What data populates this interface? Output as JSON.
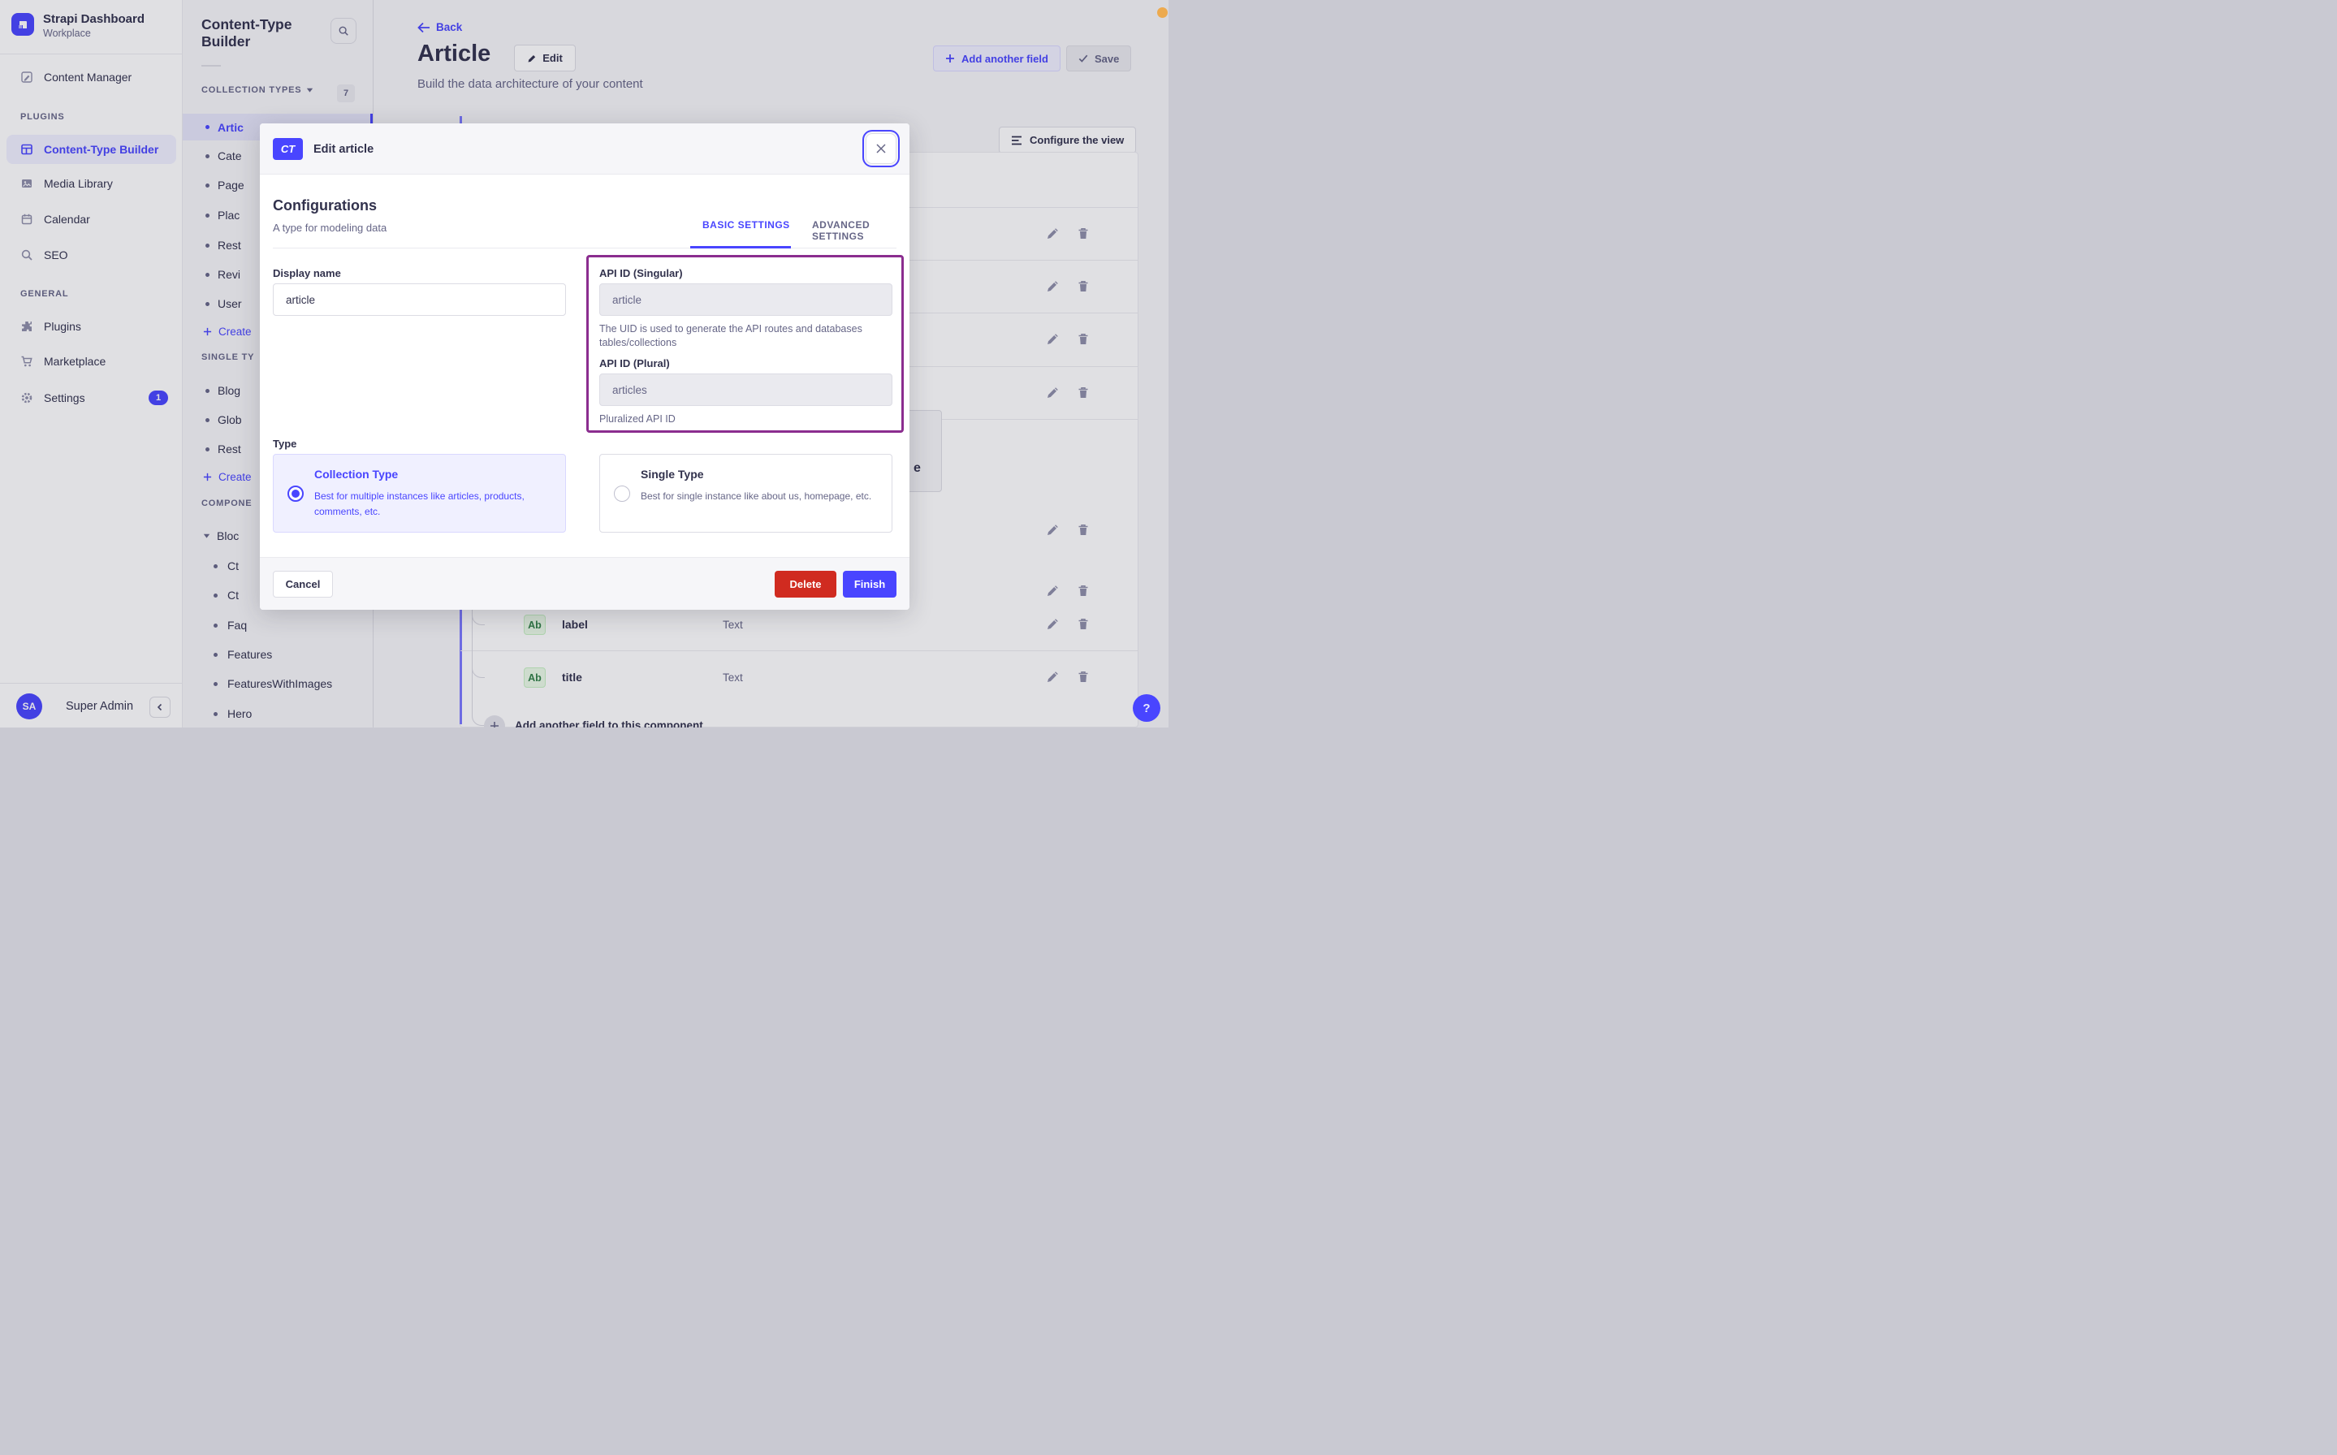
{
  "brand": {
    "title": "Strapi Dashboard",
    "workspace": "Workplace"
  },
  "nav": {
    "content_manager": "Content Manager",
    "sections": [
      {
        "title": "PLUGINS",
        "items": [
          {
            "label": "Content-Type Builder",
            "active": true
          },
          {
            "label": "Media Library"
          },
          {
            "label": "Calendar"
          },
          {
            "label": "SEO"
          }
        ]
      },
      {
        "title": "GENERAL",
        "items": [
          {
            "label": "Plugins"
          },
          {
            "label": "Marketplace"
          },
          {
            "label": "Settings",
            "badge": "1"
          }
        ]
      }
    ],
    "user": {
      "initials": "SA",
      "name": "Super Admin"
    }
  },
  "subnav": {
    "title": "Content-Type Builder",
    "collection_types": {
      "header": "COLLECTION TYPES",
      "count": "7",
      "items": [
        "Artic",
        "Cate",
        "Page",
        "Plac",
        "Rest",
        "Revi",
        "User"
      ],
      "create": "Create"
    },
    "single_types": {
      "header": "SINGLE TY",
      "items": [
        "Blog",
        "Glob",
        "Rest"
      ],
      "create": "Create"
    },
    "components": {
      "header": "COMPONE",
      "expanded_item": "Bloc",
      "items": [
        "Ct",
        "Ct",
        "Faq",
        "Features",
        "FeaturesWithImages",
        "Hero"
      ]
    }
  },
  "header": {
    "back": "Back",
    "title": "Article",
    "edit": "Edit",
    "subtitle": "Build the data architecture of your content",
    "add_field": "Add another field",
    "save": "Save",
    "configure": "Configure the view"
  },
  "fields_panel": {
    "rows": [
      {
        "badge": "Ab",
        "name": "label",
        "type": "Text"
      },
      {
        "badge": "Ab",
        "name": "title",
        "type": "Text"
      }
    ],
    "add_row": "Add another field to this component",
    "partial_text": "e"
  },
  "modal": {
    "badge": "CT",
    "title": "Edit article",
    "heading": "Configurations",
    "subheading": "A type for modeling data",
    "tabs": {
      "basic": "BASIC SETTINGS",
      "advanced": "ADVANCED SETTINGS"
    },
    "display_name": {
      "label": "Display name",
      "value": "article"
    },
    "api_singular": {
      "label": "API ID (Singular)",
      "value": "article",
      "hint": "The UID is used to generate the API routes and databases tables/collections"
    },
    "api_plural": {
      "label": "API ID (Plural)",
      "value": "articles",
      "hint": "Pluralized API ID"
    },
    "type": {
      "label": "Type",
      "options": [
        {
          "title": "Collection Type",
          "desc": "Best for multiple instances like articles, products, comments, etc.",
          "selected": true
        },
        {
          "title": "Single Type",
          "desc": "Best for single instance like about us, homepage, etc.",
          "selected": false
        }
      ]
    },
    "footer": {
      "cancel": "Cancel",
      "delete": "Delete",
      "finish": "Finish"
    }
  },
  "help": "?",
  "colors": {
    "accent": "#4945ff",
    "accent_soft": "#f0f0ff",
    "danger": "#d02b20",
    "annotation_highlight": "#8b2d8f",
    "field_badge_green": "#328048",
    "recording_dot": "#edaa4e"
  }
}
